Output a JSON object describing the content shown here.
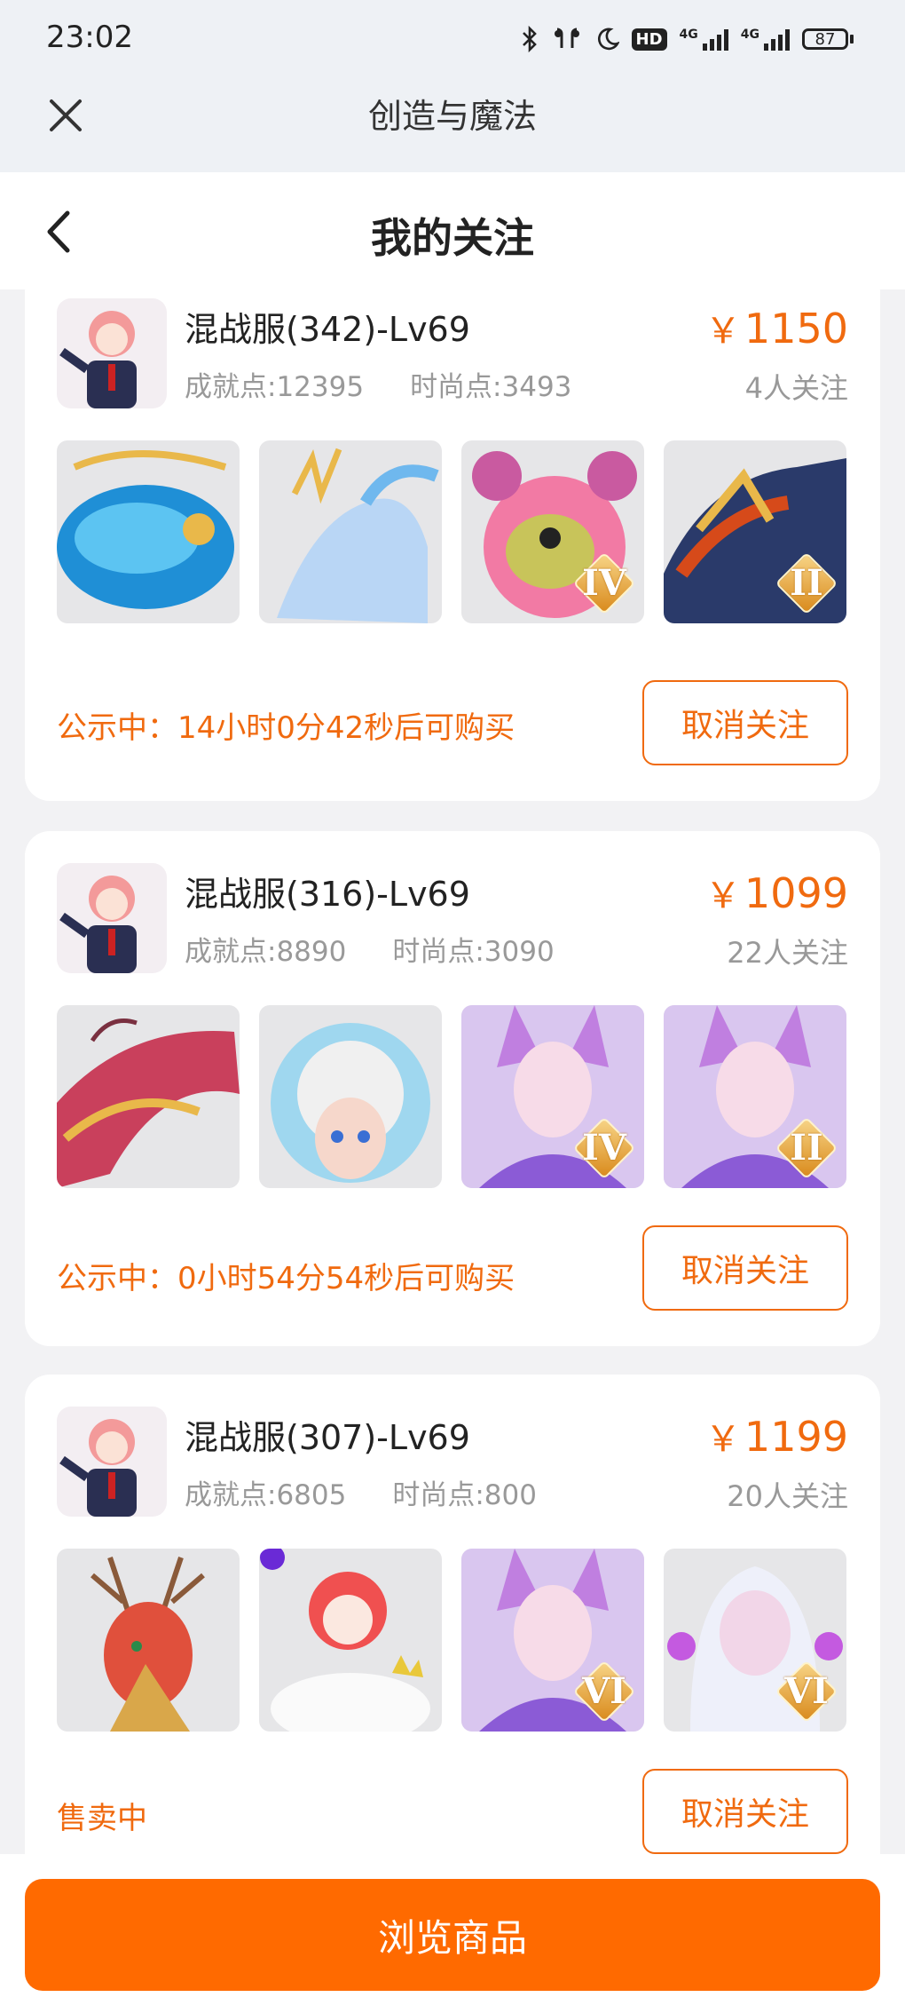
{
  "status_bar": {
    "time": "23:02",
    "network_label": "4G",
    "battery": "87",
    "icons": [
      "bluetooth-icon",
      "earbuds-icon",
      "moon-icon",
      "hd-icon",
      "signal-icon",
      "battery-icon"
    ]
  },
  "app_bar": {
    "title": "创造与魔法",
    "close_icon": "close-icon"
  },
  "page_header": {
    "title": "我的关注",
    "back_icon": "back-icon"
  },
  "listings": [
    {
      "server": "混战服(342)-Lv69",
      "achievement": "成就点:12395",
      "fashion": "时尚点:3493",
      "currency": "￥",
      "price": "1150",
      "followers": "4人关注",
      "thumbs": [
        {
          "name": "blue-whale-mount",
          "rank": ""
        },
        {
          "name": "ice-qilin-mount",
          "rank": ""
        },
        {
          "name": "pink-bear-pet",
          "rank": "IV"
        },
        {
          "name": "fire-dragon-mount",
          "rank": "II"
        }
      ],
      "status": "公示中：14小时0分42秒后可购买",
      "button": "取消关注"
    },
    {
      "server": "混战服(316)-Lv69",
      "achievement": "成就点:8890",
      "fashion": "时尚点:3090",
      "currency": "￥",
      "price": "1099",
      "followers": "22人关注",
      "thumbs": [
        {
          "name": "red-dragon-mount",
          "rank": ""
        },
        {
          "name": "cloud-girl-pet",
          "rank": ""
        },
        {
          "name": "fox-spirit",
          "rank": "IV"
        },
        {
          "name": "fox-spirit",
          "rank": "II"
        }
      ],
      "status": "公示中：0小时54分54秒后可购买",
      "button": "取消关注"
    },
    {
      "server": "混战服(307)-Lv69",
      "achievement": "成就点:6805",
      "fashion": "时尚点:800",
      "currency": "￥",
      "price": "1199",
      "followers": "20人关注",
      "thumbs": [
        {
          "name": "deer-dragon-mount",
          "rank": ""
        },
        {
          "name": "red-fox-on-cloud",
          "rank": ""
        },
        {
          "name": "fox-spirit",
          "rank": "VI"
        },
        {
          "name": "white-hair-spirit",
          "rank": "VI"
        }
      ],
      "status": "售卖中",
      "button": "取消关注"
    }
  ],
  "bottom": {
    "browse_label": "浏览商品"
  },
  "colors": {
    "accent": "#f06a0f",
    "primary_button": "#ff6a00",
    "muted_text": "#999999"
  }
}
